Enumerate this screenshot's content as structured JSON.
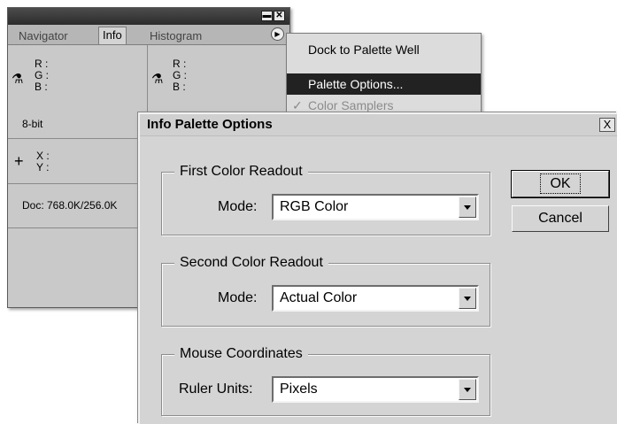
{
  "info_palette": {
    "tabs": [
      "Navigator",
      "Info",
      "Histogram"
    ],
    "active_tab": "Info",
    "titlebar_buttons": [
      "minimize",
      "close"
    ],
    "menu_button_icon": "triangle-right-icon",
    "readout1": {
      "r": "R :",
      "g": "G :",
      "b": "B :"
    },
    "readout2": {
      "r": "R :",
      "g": "G :",
      "b": "B :"
    },
    "bit_depth": "8-bit",
    "coords": {
      "x": "X :",
      "y": "Y :"
    },
    "doc_size": "Doc: 768.0K/256.0K"
  },
  "flyout_menu": {
    "items": [
      {
        "label": "Dock to Palette Well",
        "state": "normal"
      },
      {
        "label": "Palette Options...",
        "state": "selected"
      },
      {
        "label": "Color Samplers",
        "state": "checked-disabled"
      }
    ]
  },
  "dialog": {
    "title": "Info Palette Options",
    "close_label": "X",
    "groups": [
      {
        "legend": "First Color Readout",
        "label": "Mode:",
        "value": "RGB Color"
      },
      {
        "legend": "Second Color Readout",
        "label": "Mode:",
        "value": "Actual Color"
      },
      {
        "legend": "Mouse Coordinates",
        "label": "Ruler Units:",
        "value": "Pixels"
      }
    ],
    "buttons": {
      "ok": "OK",
      "cancel": "Cancel"
    }
  }
}
